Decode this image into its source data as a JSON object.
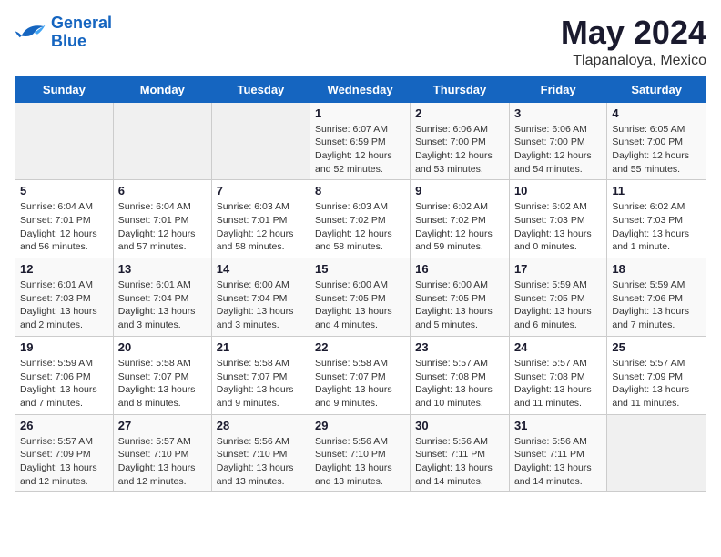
{
  "logo": {
    "line1": "General",
    "line2": "Blue"
  },
  "title": {
    "month_year": "May 2024",
    "location": "Tlapanaloya, Mexico"
  },
  "weekdays": [
    "Sunday",
    "Monday",
    "Tuesday",
    "Wednesday",
    "Thursday",
    "Friday",
    "Saturday"
  ],
  "weeks": [
    [
      {
        "day": "",
        "info": ""
      },
      {
        "day": "",
        "info": ""
      },
      {
        "day": "",
        "info": ""
      },
      {
        "day": "1",
        "info": "Sunrise: 6:07 AM\nSunset: 6:59 PM\nDaylight: 12 hours and 52 minutes."
      },
      {
        "day": "2",
        "info": "Sunrise: 6:06 AM\nSunset: 7:00 PM\nDaylight: 12 hours and 53 minutes."
      },
      {
        "day": "3",
        "info": "Sunrise: 6:06 AM\nSunset: 7:00 PM\nDaylight: 12 hours and 54 minutes."
      },
      {
        "day": "4",
        "info": "Sunrise: 6:05 AM\nSunset: 7:00 PM\nDaylight: 12 hours and 55 minutes."
      }
    ],
    [
      {
        "day": "5",
        "info": "Sunrise: 6:04 AM\nSunset: 7:01 PM\nDaylight: 12 hours and 56 minutes."
      },
      {
        "day": "6",
        "info": "Sunrise: 6:04 AM\nSunset: 7:01 PM\nDaylight: 12 hours and 57 minutes."
      },
      {
        "day": "7",
        "info": "Sunrise: 6:03 AM\nSunset: 7:01 PM\nDaylight: 12 hours and 58 minutes."
      },
      {
        "day": "8",
        "info": "Sunrise: 6:03 AM\nSunset: 7:02 PM\nDaylight: 12 hours and 58 minutes."
      },
      {
        "day": "9",
        "info": "Sunrise: 6:02 AM\nSunset: 7:02 PM\nDaylight: 12 hours and 59 minutes."
      },
      {
        "day": "10",
        "info": "Sunrise: 6:02 AM\nSunset: 7:03 PM\nDaylight: 13 hours and 0 minutes."
      },
      {
        "day": "11",
        "info": "Sunrise: 6:02 AM\nSunset: 7:03 PM\nDaylight: 13 hours and 1 minute."
      }
    ],
    [
      {
        "day": "12",
        "info": "Sunrise: 6:01 AM\nSunset: 7:03 PM\nDaylight: 13 hours and 2 minutes."
      },
      {
        "day": "13",
        "info": "Sunrise: 6:01 AM\nSunset: 7:04 PM\nDaylight: 13 hours and 3 minutes."
      },
      {
        "day": "14",
        "info": "Sunrise: 6:00 AM\nSunset: 7:04 PM\nDaylight: 13 hours and 3 minutes."
      },
      {
        "day": "15",
        "info": "Sunrise: 6:00 AM\nSunset: 7:05 PM\nDaylight: 13 hours and 4 minutes."
      },
      {
        "day": "16",
        "info": "Sunrise: 6:00 AM\nSunset: 7:05 PM\nDaylight: 13 hours and 5 minutes."
      },
      {
        "day": "17",
        "info": "Sunrise: 5:59 AM\nSunset: 7:05 PM\nDaylight: 13 hours and 6 minutes."
      },
      {
        "day": "18",
        "info": "Sunrise: 5:59 AM\nSunset: 7:06 PM\nDaylight: 13 hours and 7 minutes."
      }
    ],
    [
      {
        "day": "19",
        "info": "Sunrise: 5:59 AM\nSunset: 7:06 PM\nDaylight: 13 hours and 7 minutes."
      },
      {
        "day": "20",
        "info": "Sunrise: 5:58 AM\nSunset: 7:07 PM\nDaylight: 13 hours and 8 minutes."
      },
      {
        "day": "21",
        "info": "Sunrise: 5:58 AM\nSunset: 7:07 PM\nDaylight: 13 hours and 9 minutes."
      },
      {
        "day": "22",
        "info": "Sunrise: 5:58 AM\nSunset: 7:07 PM\nDaylight: 13 hours and 9 minutes."
      },
      {
        "day": "23",
        "info": "Sunrise: 5:57 AM\nSunset: 7:08 PM\nDaylight: 13 hours and 10 minutes."
      },
      {
        "day": "24",
        "info": "Sunrise: 5:57 AM\nSunset: 7:08 PM\nDaylight: 13 hours and 11 minutes."
      },
      {
        "day": "25",
        "info": "Sunrise: 5:57 AM\nSunset: 7:09 PM\nDaylight: 13 hours and 11 minutes."
      }
    ],
    [
      {
        "day": "26",
        "info": "Sunrise: 5:57 AM\nSunset: 7:09 PM\nDaylight: 13 hours and 12 minutes."
      },
      {
        "day": "27",
        "info": "Sunrise: 5:57 AM\nSunset: 7:10 PM\nDaylight: 13 hours and 12 minutes."
      },
      {
        "day": "28",
        "info": "Sunrise: 5:56 AM\nSunset: 7:10 PM\nDaylight: 13 hours and 13 minutes."
      },
      {
        "day": "29",
        "info": "Sunrise: 5:56 AM\nSunset: 7:10 PM\nDaylight: 13 hours and 13 minutes."
      },
      {
        "day": "30",
        "info": "Sunrise: 5:56 AM\nSunset: 7:11 PM\nDaylight: 13 hours and 14 minutes."
      },
      {
        "day": "31",
        "info": "Sunrise: 5:56 AM\nSunset: 7:11 PM\nDaylight: 13 hours and 14 minutes."
      },
      {
        "day": "",
        "info": ""
      }
    ]
  ]
}
